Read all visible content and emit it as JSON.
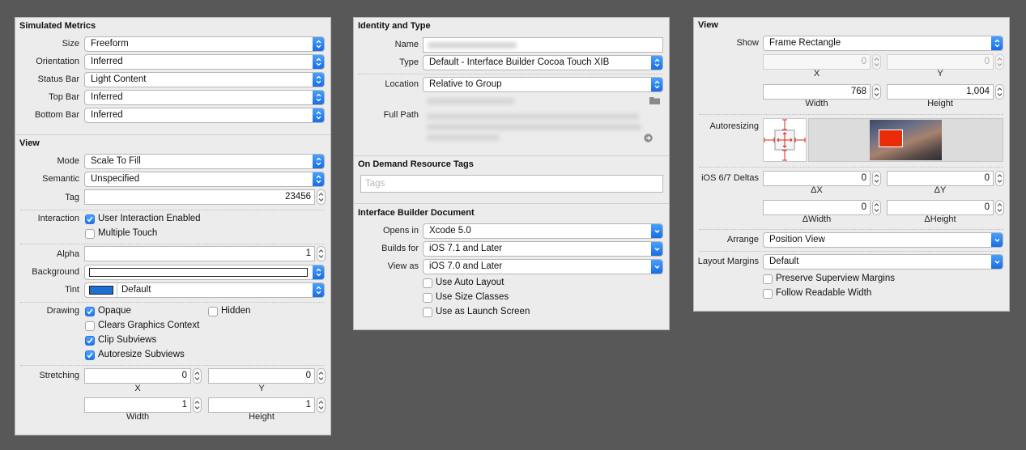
{
  "left": {
    "simulated_metrics": {
      "header": "Simulated Metrics",
      "rows": [
        {
          "label": "Size",
          "value": "Freeform"
        },
        {
          "label": "Orientation",
          "value": "Inferred"
        },
        {
          "label": "Status Bar",
          "value": "Light Content"
        },
        {
          "label": "Top Bar",
          "value": "Inferred"
        },
        {
          "label": "Bottom Bar",
          "value": "Inferred"
        }
      ]
    },
    "view": {
      "header": "View",
      "mode_label": "Mode",
      "mode_value": "Scale To Fill",
      "semantic_label": "Semantic",
      "semantic_value": "Unspecified",
      "tag_label": "Tag",
      "tag_value": "23456",
      "interaction_label": "Interaction",
      "user_interaction": "User Interaction Enabled",
      "multiple_touch": "Multiple Touch",
      "alpha_label": "Alpha",
      "alpha_value": "1",
      "background_label": "Background",
      "tint_label": "Tint",
      "tint_value": "Default",
      "tint_color": "#1f6fd6",
      "drawing_label": "Drawing",
      "opaque": "Opaque",
      "hidden": "Hidden",
      "clears_graphics": "Clears Graphics Context",
      "clip_subviews": "Clip Subviews",
      "autoresize_subviews": "Autoresize Subviews",
      "stretching_label": "Stretching",
      "stretch_x": "0",
      "stretch_y": "0",
      "stretch_w": "1",
      "stretch_h": "1",
      "x_label": "X",
      "y_label": "Y",
      "width_label": "Width",
      "height_label": "Height"
    }
  },
  "middle": {
    "identity": {
      "header": "Identity and Type",
      "name_label": "Name",
      "type_label": "Type",
      "type_value": "Default - Interface Builder Cocoa Touch XIB",
      "location_label": "Location",
      "location_value": "Relative to Group",
      "full_path_label": "Full Path"
    },
    "on_demand": {
      "header": "On Demand Resource Tags",
      "tags_placeholder": "Tags"
    },
    "ib_document": {
      "header": "Interface Builder Document",
      "opens_in_label": "Opens in",
      "opens_in_value": "Xcode 5.0",
      "builds_for_label": "Builds for",
      "builds_for_value": "iOS 7.1 and Later",
      "view_as_label": "View as",
      "view_as_value": "iOS 7.0 and Later",
      "use_auto_layout": "Use Auto Layout",
      "use_size_classes": "Use Size Classes",
      "use_as_launch": "Use as Launch Screen"
    }
  },
  "right": {
    "header": "View",
    "show_label": "Show",
    "show_value": "Frame Rectangle",
    "x_value": "0",
    "y_value": "0",
    "x_label": "X",
    "y_label": "Y",
    "width_value": "768",
    "height_value": "1,004",
    "width_label": "Width",
    "height_label": "Height",
    "autoresizing_label": "Autoresizing",
    "deltas_label": "iOS 6/7 Deltas",
    "dx_value": "0",
    "dy_value": "0",
    "dw_value": "0",
    "dh_value": "0",
    "dx_label": "ΔX",
    "dy_label": "ΔY",
    "dw_label": "ΔWidth",
    "dh_label": "ΔHeight",
    "arrange_label": "Arrange",
    "arrange_value": "Position View",
    "layout_margins_label": "Layout Margins",
    "layout_margins_value": "Default",
    "preserve_superview": "Preserve Superview Margins",
    "follow_readable": "Follow Readable Width",
    "accent_color": "#2a7cf0",
    "preview_view_color": "#ea2b0a"
  }
}
